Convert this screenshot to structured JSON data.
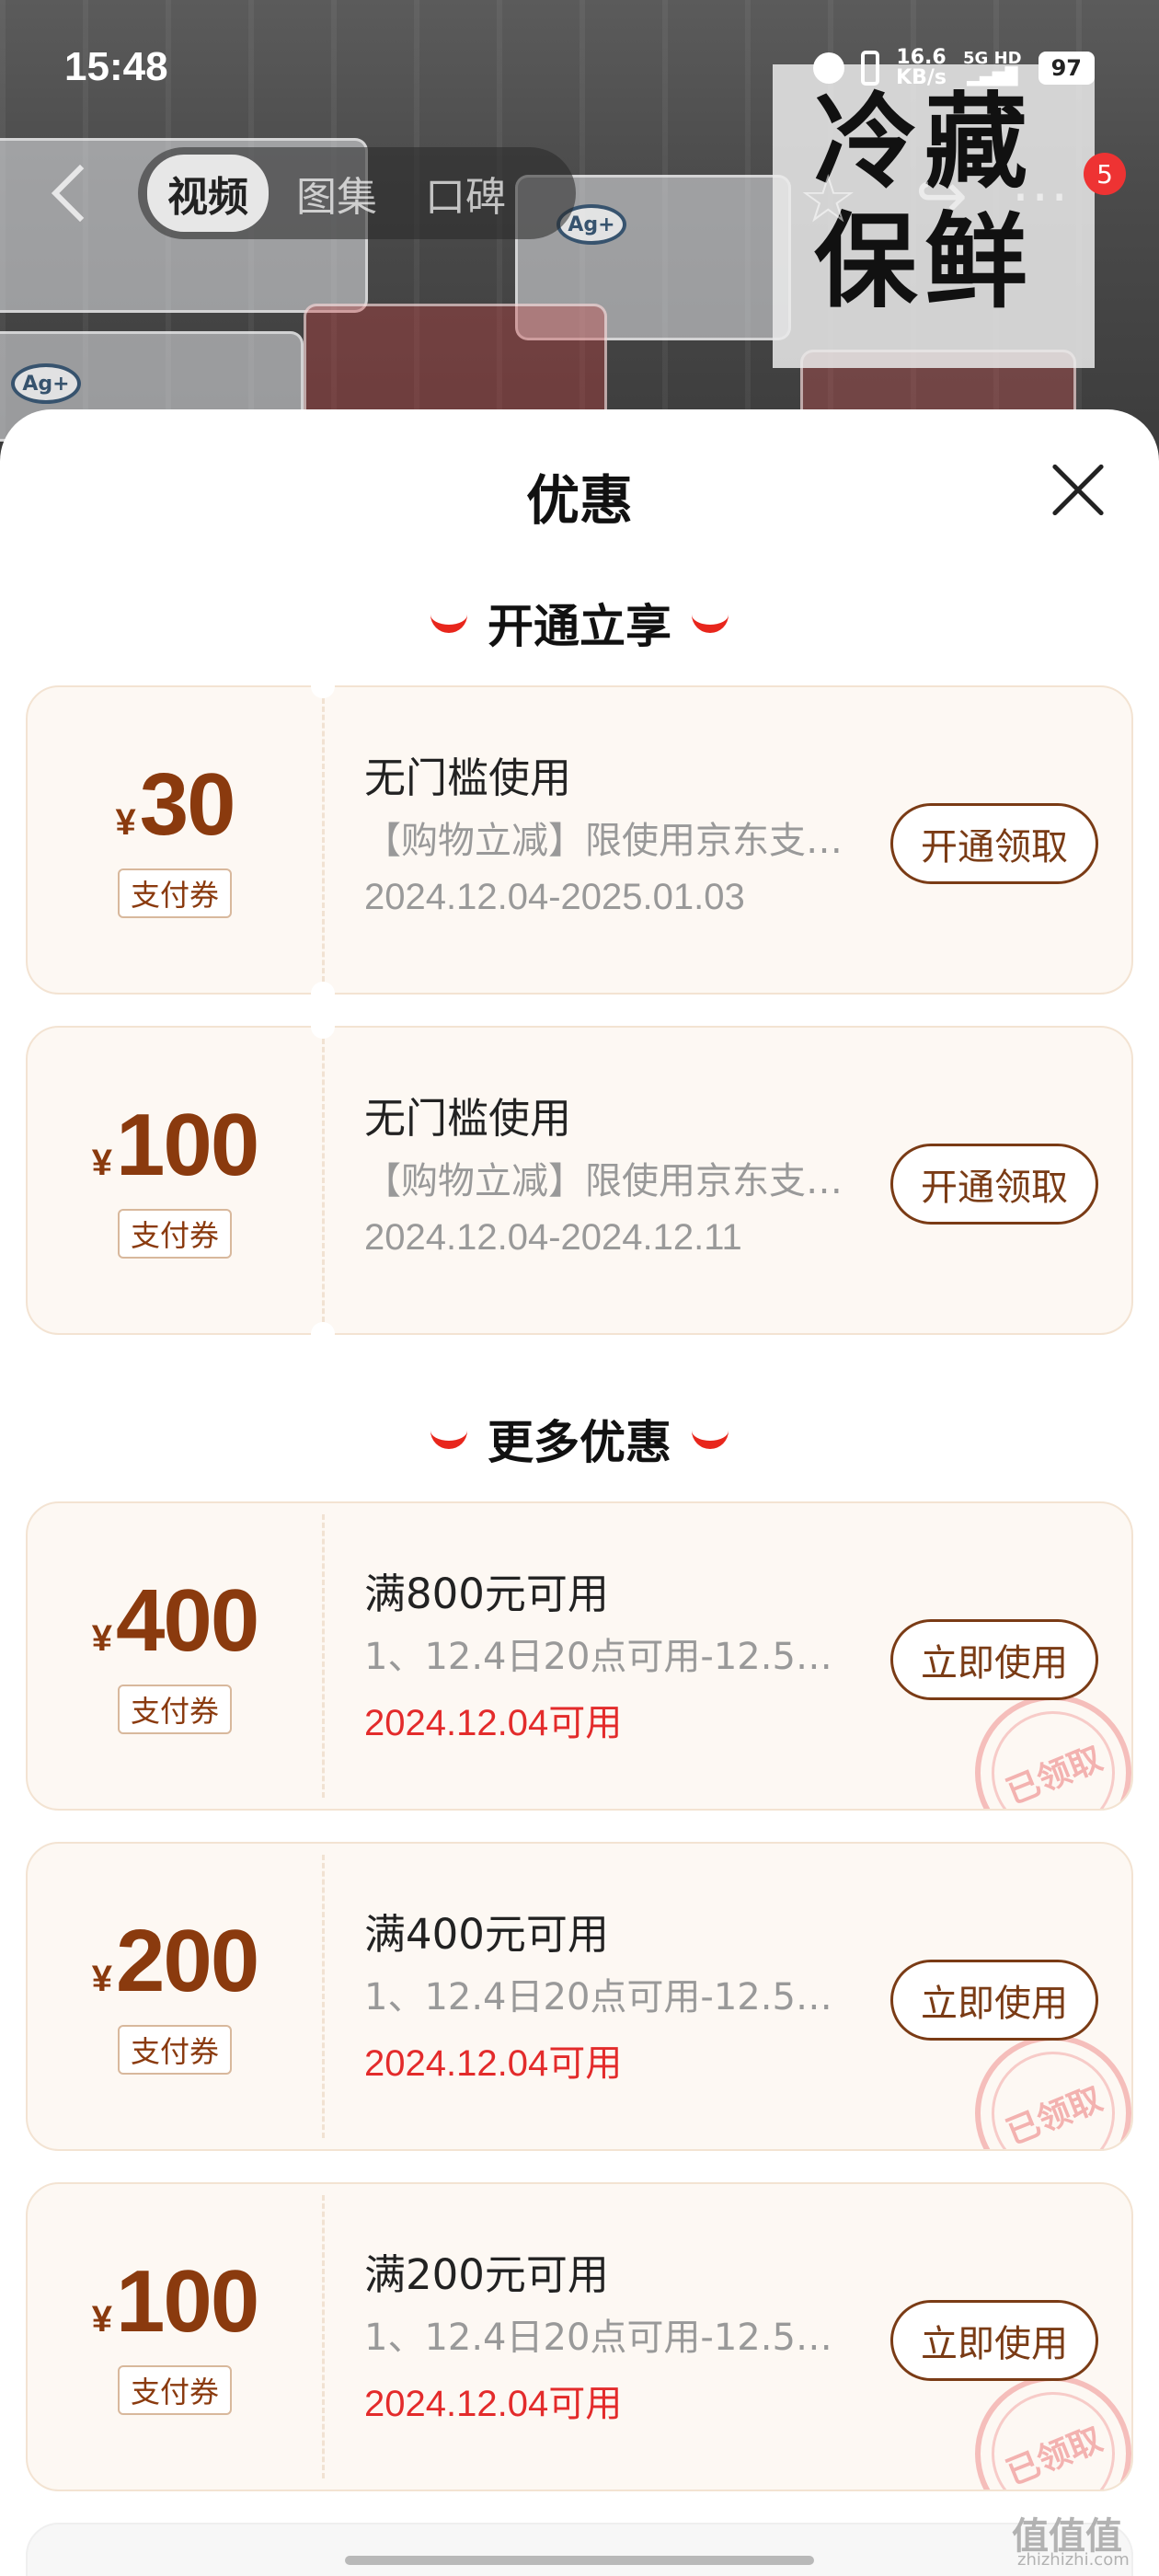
{
  "status_bar": {
    "time": "15:48",
    "speed_value": "16.6",
    "speed_unit": "KB/s",
    "network": "5G HD",
    "battery": "97"
  },
  "product": {
    "promo_line1": "冷藏",
    "promo_line2": "保鲜",
    "ag_label": "Ag+"
  },
  "nav": {
    "tabs": [
      "视频",
      "图集",
      "口碑"
    ],
    "active_tab": 0,
    "badge_count": "5"
  },
  "sheet": {
    "title": "优惠",
    "section1_title": "开通立享",
    "section2_title": "更多优惠",
    "currency_symbol": "¥",
    "coupons": [
      {
        "amount": "30",
        "type": "支付券",
        "title": "无门槛使用",
        "desc": "【购物立减】限使用京东支…",
        "date": "2024.12.04-2025.01.03",
        "button": "开通领取",
        "claimed": false
      },
      {
        "amount": "100",
        "type": "支付券",
        "title": "无门槛使用",
        "desc": "【购物立减】限使用京东支…",
        "date": "2024.12.04-2024.12.11",
        "button": "开通领取",
        "claimed": false
      },
      {
        "amount": "400",
        "type": "支付券",
        "title": "满800元可用",
        "desc": "1、12.4日20点可用-12.5…",
        "date": "2024.12.04可用",
        "button": "立即使用",
        "claimed": true,
        "stamp": "已领取"
      },
      {
        "amount": "200",
        "type": "支付券",
        "title": "满400元可用",
        "desc": "1、12.4日20点可用-12.5…",
        "date": "2024.12.04可用",
        "button": "立即使用",
        "claimed": true,
        "stamp": "已领取"
      },
      {
        "amount": "100",
        "type": "支付券",
        "title": "满200元可用",
        "desc": "1、12.4日20点可用-12.5…",
        "date": "2024.12.04可用",
        "button": "立即使用",
        "claimed": true,
        "stamp": "已领取"
      }
    ]
  },
  "watermark": {
    "logo": "值值值",
    "site": "zhizhizhi.com"
  },
  "colors": {
    "accent_brown": "#8a3a0e",
    "date_red": "#e32b2b",
    "smile_red": "#e8261c",
    "coupon_bg": "#fdf8f3"
  }
}
